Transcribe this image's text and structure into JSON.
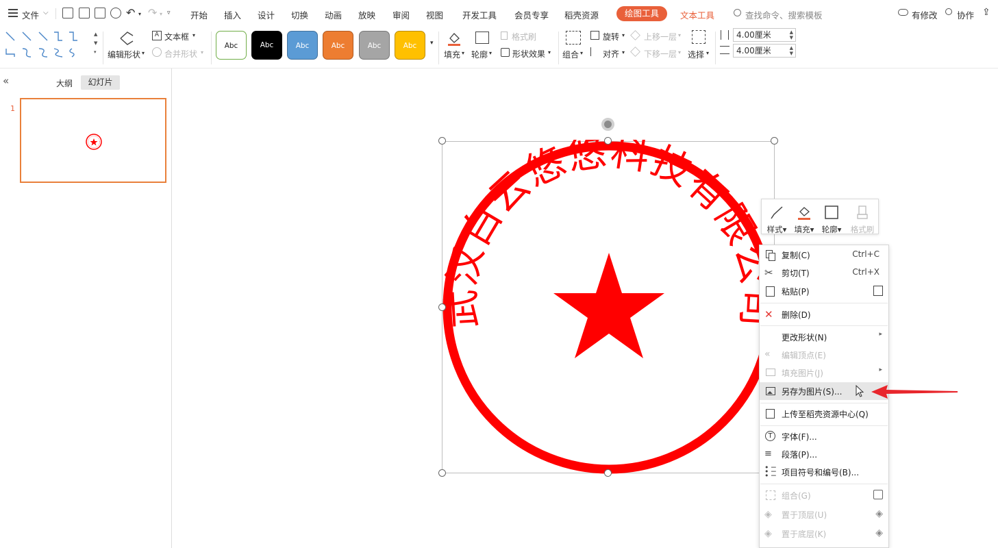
{
  "menubar": {
    "file": "文件",
    "tabs": [
      "开始",
      "插入",
      "设计",
      "切换",
      "动画",
      "放映",
      "审阅",
      "视图",
      "开发工具",
      "会员专享",
      "稻壳资源"
    ],
    "drawing_tools": "绘图工具",
    "text_tools": "文本工具",
    "search_placeholder": "查找命令、搜索模板",
    "modified": "有修改",
    "collab": "协作"
  },
  "ribbon": {
    "edit_shape": "编辑形状",
    "text_box": "文本框",
    "merge_shape": "合并形状",
    "style_label": "Abc",
    "format_brush": "格式刷",
    "fill": "填充",
    "outline": "轮廓",
    "shape_effect": "形状效果",
    "rotate": "旋转",
    "bring_forward": "上移一层",
    "send_backward": "下移一层",
    "group": "组合",
    "align": "对齐",
    "select": "选择",
    "height": "4.00厘米",
    "width": "4.00厘米"
  },
  "colors": {
    "accent": "#e9603a",
    "seal": "#ff0000",
    "style_fills": [
      "#ffffff",
      "#000000",
      "#5b9bd5",
      "#ed7d31",
      "#a5a5a5",
      "#ffc000"
    ]
  },
  "left_panel": {
    "tab_outline": "大纲",
    "tab_slides": "幻灯片",
    "slide_number": "1"
  },
  "seal": {
    "company": "武汉白云悠悠科技有限公司"
  },
  "mini_toolbar": {
    "style": "样式",
    "fill": "填充",
    "outline": "轮廓",
    "format_brush": "格式刷"
  },
  "context_menu": {
    "copy": "复制(C)",
    "copy_sc": "Ctrl+C",
    "cut": "剪切(T)",
    "cut_sc": "Ctrl+X",
    "paste": "粘贴(P)",
    "delete": "删除(D)",
    "change_shape": "更改形状(N)",
    "edit_points": "编辑顶点(E)",
    "fill_picture": "填充图片(J)",
    "save_as_picture": "另存为图片(S)...",
    "upload": "上传至稻壳资源中心(Q)",
    "font": "字体(F)...",
    "paragraph": "段落(P)...",
    "bullets": "项目符号和编号(B)...",
    "group": "组合(G)",
    "bring_to_front": "置于顶层(U)",
    "send_to_back": "置于底层(K)"
  }
}
